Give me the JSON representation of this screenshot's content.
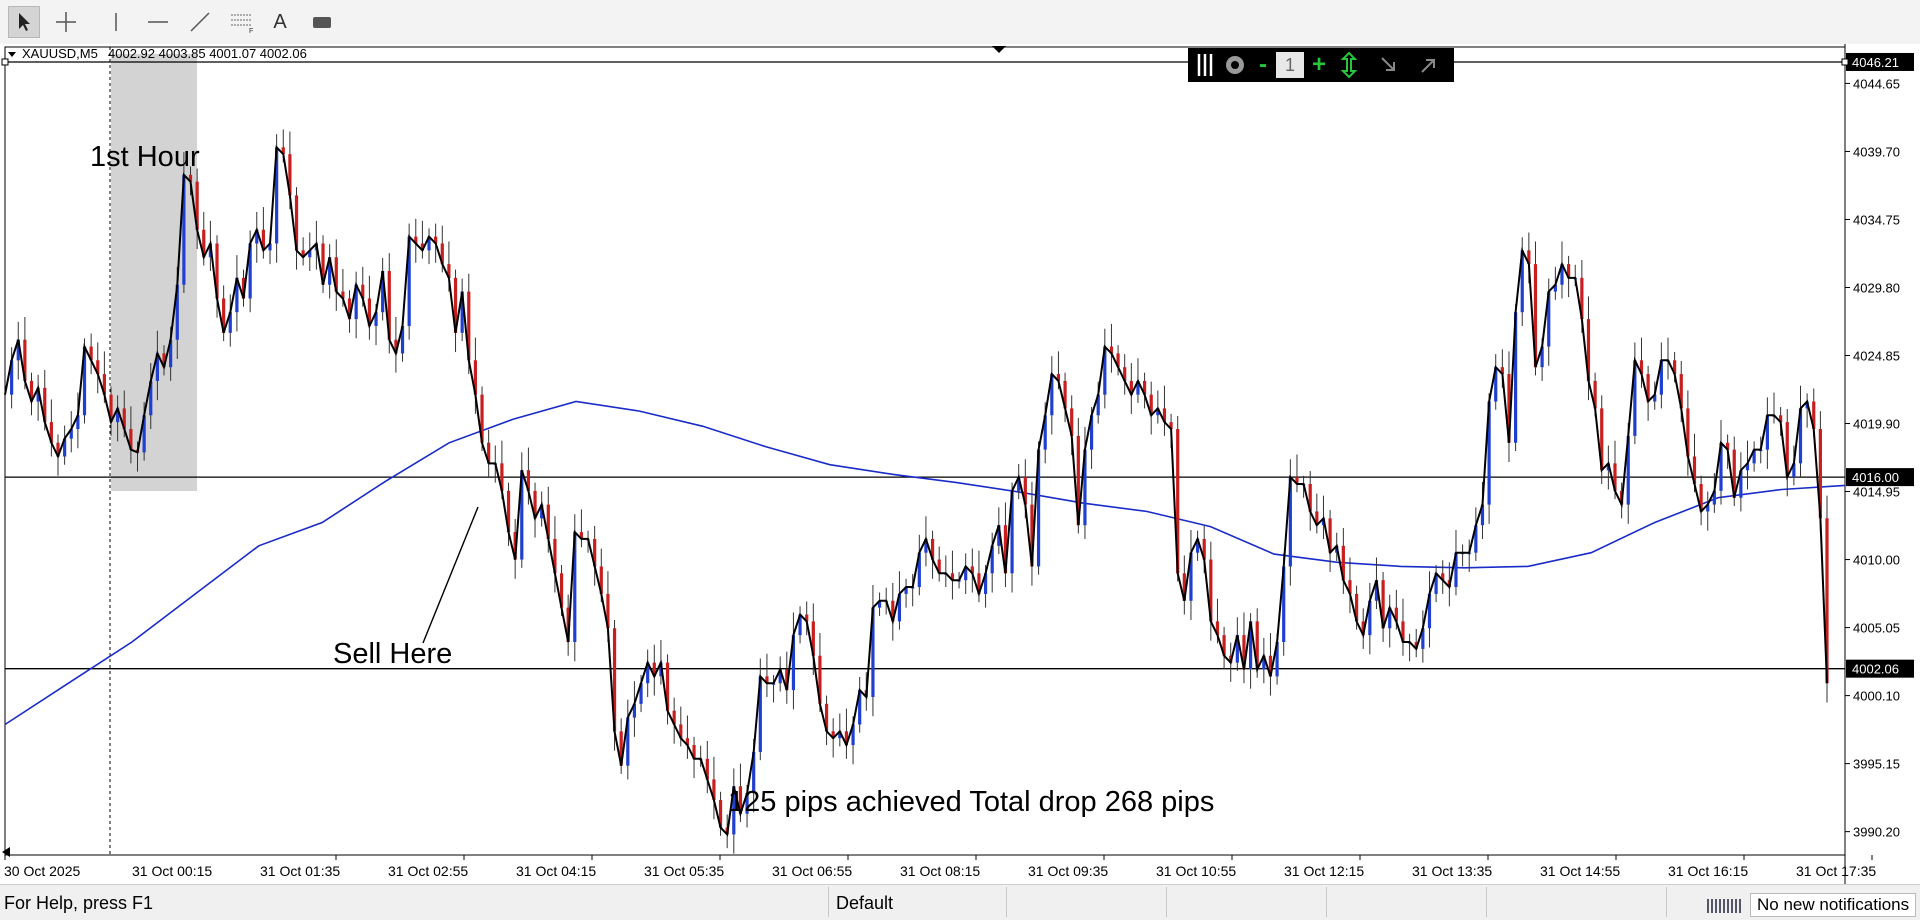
{
  "toolbar": {
    "tools": [
      "cursor-icon",
      "crosshair-icon",
      "vertical-line-icon",
      "horizontal-line-icon",
      "trendline-icon",
      "fibonacci-icon",
      "text-icon",
      "label-icon"
    ],
    "text_tool_label": "A"
  },
  "chart_header": {
    "symbol": "XAUUSD,M5",
    "ohlc": "4002.92 4003.85 4001.07 4002.06"
  },
  "one_click_panel": {
    "lot_value": "1",
    "minus_label": "-",
    "plus_label": "+"
  },
  "annotations": {
    "first_hour": "1st Hour",
    "sell_here": "Sell Here",
    "result": "125 pips achieved  Total drop 268 pips"
  },
  "colors": {
    "bull_candle": "#1f3fd0",
    "bear_candle": "#c81e1e",
    "moving_average": "#1a2cc8",
    "price_line": "#000000",
    "first_hour_box": "#d3d3d3",
    "price_tag_bg": "#000000"
  },
  "chart_data": {
    "type": "line",
    "price_axis_ticks": [
      "4044.65",
      "4039.70",
      "4034.75",
      "4029.80",
      "4024.85",
      "4019.90",
      "4014.95",
      "4010.00",
      "4005.05",
      "4000.10",
      "3995.15",
      "3990.20"
    ],
    "price_tags": [
      "4046.21",
      "4016.00",
      "4002.06"
    ],
    "time_axis_ticks": [
      "30 Oct 2025",
      "31 Oct 00:15",
      "31 Oct 01:35",
      "31 Oct 02:55",
      "31 Oct 04:15",
      "31 Oct 05:35",
      "31 Oct 06:55",
      "31 Oct 08:15",
      "31 Oct 09:35",
      "31 Oct 10:55",
      "31 Oct 12:15",
      "31 Oct 13:35",
      "31 Oct 14:55",
      "31 Oct 16:15",
      "31 Oct 17:35"
    ],
    "ylim": [
      3988.5,
      4047.3
    ],
    "horizontal_levels": [
      4046.21,
      4016.0,
      4002.06
    ],
    "series": [
      {
        "values": [
          4022.0,
          4024.5,
          4026.0,
          4023.0,
          4021.5,
          4022.5,
          4020.0,
          4018.5,
          4017.5,
          4018.8,
          4019.5,
          4020.5,
          4025.5,
          4024.5,
          4023.5,
          4022.0,
          4020.0,
          4021.0,
          4019.5,
          4018.0,
          4017.8,
          4020.5,
          4023.0,
          4025.0,
          4024.0,
          4026.0,
          4030.0,
          4038.0,
          4037.5,
          4034.0,
          4032.0,
          4033.0,
          4029.0,
          4026.5,
          4028.0,
          4030.5,
          4029.0,
          4033.0,
          4034.0,
          4032.5,
          4033.0,
          4040.0,
          4039.5,
          4036.5,
          4032.5,
          4032.0,
          4032.5,
          4033.0,
          4030.0,
          4032.0,
          4029.5,
          4029.0,
          4027.5,
          4030.0,
          4029.0,
          4027.0,
          4028.0,
          4031.0,
          4026.0,
          4025.0,
          4027.0,
          4033.5,
          4033.0,
          4032.5,
          4033.5,
          4033.0,
          4031.5,
          4030.5,
          4026.5,
          4029.5,
          4024.5,
          4022.0,
          4018.5,
          4017.0,
          4017.0,
          4015.0,
          4012.0,
          4010.0,
          4016.5,
          4015.0,
          4013.0,
          4014.0,
          4011.5,
          4009.0,
          4006.5,
          4004.0,
          4012.0,
          4011.5,
          4011.5,
          4009.5,
          4007.5,
          4005.0,
          3997.5,
          3995.0,
          3998.5,
          3999.5,
          4001.0,
          4002.5,
          4001.5,
          4002.5,
          3999.0,
          3998.0,
          3997.0,
          3996.5,
          3995.5,
          3995.5,
          3994.0,
          3992.5,
          3990.5,
          3990.0,
          3993.5,
          3991.5,
          3993.0,
          3996.0,
          4001.5,
          4001.0,
          4001.0,
          4002.0,
          4000.5,
          4004.5,
          4006.0,
          4005.5,
          4003.0,
          3999.5,
          3997.5,
          3997.0,
          3997.5,
          3996.5,
          3998.0,
          4000.5,
          4000.0,
          4006.5,
          4007.0,
          4007.0,
          4005.5,
          4007.5,
          4008.0,
          4008.0,
          4010.5,
          4011.5,
          4010.0,
          4009.0,
          4009.0,
          4008.5,
          4008.5,
          4009.5,
          4009.0,
          4007.5,
          4009.0,
          4011.0,
          4012.5,
          4009.0,
          4015.0,
          4016.0,
          4014.0,
          4009.5,
          4018.0,
          4020.5,
          4023.5,
          4023.0,
          4021.0,
          4019.0,
          4012.5,
          4018.0,
          4020.5,
          4022.0,
          4025.5,
          4025.0,
          4024.0,
          4023.0,
          4022.0,
          4023.0,
          4022.0,
          4020.5,
          4021.0,
          4020.0,
          4019.5,
          4009.0,
          4007.0,
          4010.5,
          4011.5,
          4010.0,
          4005.5,
          4004.5,
          4003.0,
          4002.5,
          4004.5,
          4002.0,
          4005.5,
          4002.0,
          4003.0,
          4001.5,
          4004.0,
          4009.5,
          4016.0,
          4015.5,
          4015.5,
          4013.5,
          4012.5,
          4013.0,
          4010.5,
          4011.0,
          4008.5,
          4007.5,
          4005.5,
          4004.5,
          4007.0,
          4008.5,
          4005.0,
          4006.5,
          4005.5,
          4004.0,
          4004.0,
          4003.5,
          4005.0,
          4007.5,
          4009.0,
          4008.5,
          4008.0,
          4010.5,
          4010.5,
          4010.5,
          4012.5,
          4014.0,
          4021.5,
          4024.0,
          4023.5,
          4018.5,
          4028.0,
          4032.5,
          4031.5,
          4024.0,
          4025.5,
          4029.5,
          4030.0,
          4031.5,
          4030.5,
          4030.5,
          4027.5,
          4023.0,
          4021.0,
          4016.5,
          4017.0,
          4015.0,
          4014.0,
          4019.0,
          4024.5,
          4023.5,
          4021.5,
          4022.0,
          4024.5,
          4024.5,
          4023.5,
          4021.0,
          4017.5,
          4015.5,
          4013.5,
          4014.0,
          4015.0,
          4018.5,
          4018.0,
          4014.5,
          4016.5,
          4017.0,
          4018.0,
          4018.0,
          4020.5,
          4020.5,
          4020.0,
          4016.0,
          4017.0,
          4021.0,
          4021.5,
          4019.5,
          4013.0,
          4001.0
        ]
      },
      {
        "name": "",
        "values": [
          3998.0,
          4001.0,
          4004.0,
          4007.5,
          4011.0,
          4012.7,
          4015.7,
          4018.5,
          4020.2,
          4021.5,
          4020.8,
          4019.7,
          4018.2,
          4016.9,
          4016.2,
          4015.6,
          4014.9,
          4014.1,
          4013.5,
          4012.4,
          4010.4,
          4009.8,
          4009.5,
          4009.4,
          4009.5,
          4010.5,
          4012.7,
          4014.5,
          4015.1,
          4015.4
        ]
      }
    ]
  },
  "status": {
    "help": "For Help, press F1",
    "profile": "Default",
    "notifications": "No new notifications"
  }
}
